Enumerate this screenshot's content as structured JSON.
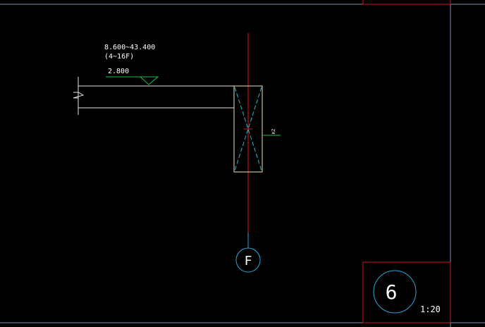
{
  "colors": {
    "background": "#000000",
    "frame_line": "#7f8fb0",
    "title_block": "#d01020",
    "slab_outline": "#e8e0d8",
    "column_outline": "#f0e0b0",
    "centerline": "#e01818",
    "grid_circle": "#2aa8d8",
    "column_diagonal": "#20b8c8",
    "level_mark": "#20c040",
    "dimension_text": "#e8e020",
    "text": "#ffffff"
  },
  "annotations": {
    "elevation_range": "8.600~43.400",
    "floor_range": "(4~16F)",
    "level_value": "2.800",
    "column_tag": "KZ"
  },
  "grid": {
    "axis_label": "F"
  },
  "detail": {
    "number": "6",
    "scale": "1:20"
  }
}
